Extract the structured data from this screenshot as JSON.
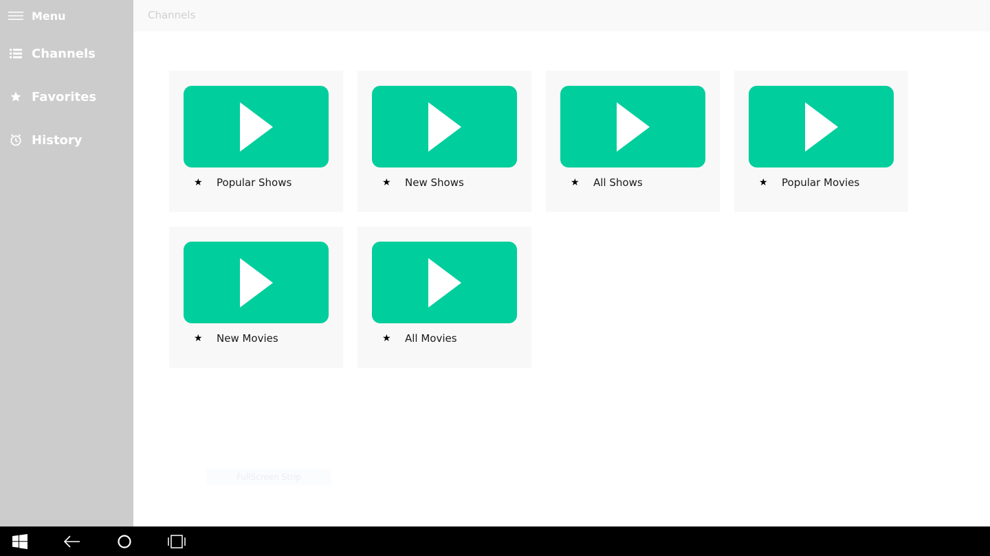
{
  "sidebar": {
    "menu_label": "Menu",
    "items": [
      {
        "label": "Channels",
        "icon": "list-icon"
      },
      {
        "label": "Favorites",
        "icon": "star-icon"
      },
      {
        "label": "History",
        "icon": "history-icon"
      }
    ]
  },
  "header": {
    "title": "Channels"
  },
  "tiles": [
    {
      "label": "Popular Shows",
      "star": "★"
    },
    {
      "label": "New Shows",
      "star": "★"
    },
    {
      "label": "All Shows",
      "star": "★"
    },
    {
      "label": "Popular Movies",
      "star": "★"
    },
    {
      "label": "New Movies",
      "star": "★"
    },
    {
      "label": "All Movies",
      "star": "★"
    }
  ],
  "ghost_text": "FullScreen Strip",
  "colors": {
    "sidebar_bg": "#cccccc",
    "accent": "#00ce9c",
    "tile_bg": "#f8f8f8",
    "taskbar_bg": "#000000"
  },
  "taskbar": {
    "icons": [
      "windows-start-icon",
      "back-arrow-icon",
      "cortana-circle-icon",
      "task-view-icon"
    ]
  }
}
